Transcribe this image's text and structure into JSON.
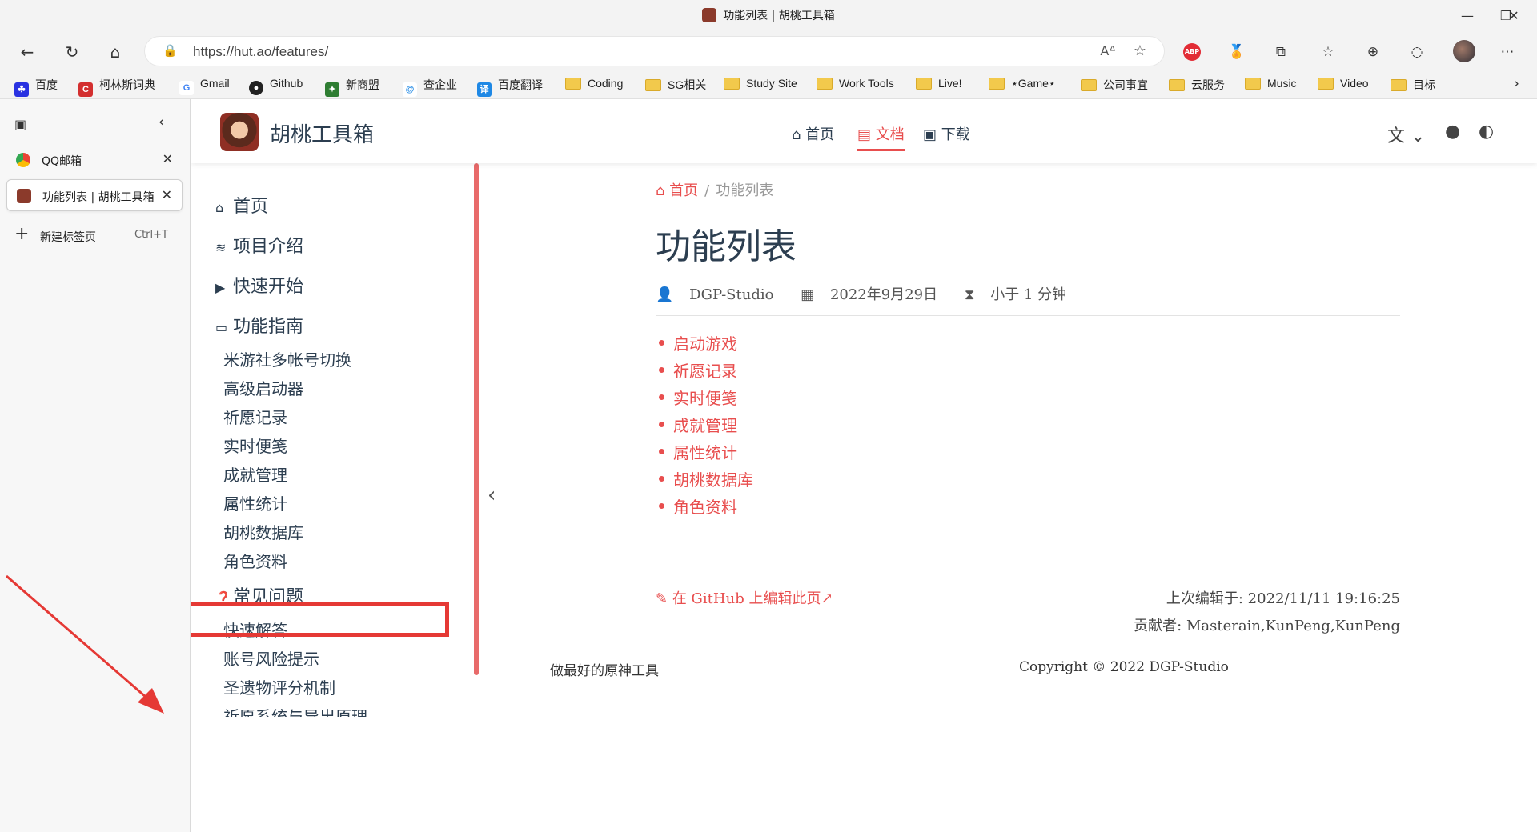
{
  "browser": {
    "window_title": "功能列表 | 胡桃工具箱",
    "url": "https://hut.ao/features/",
    "bookmarks": [
      "百度",
      "柯林斯词典",
      "Gmail",
      "Github",
      "新商盟",
      "查企业",
      "百度翻译",
      "Coding",
      "SG相关",
      "Study Site",
      "Work Tools",
      "Live!",
      "⋆Game⋆",
      "公司事宜",
      "云服务",
      "Music",
      "Video",
      "目标"
    ],
    "vertical_tabs": [
      {
        "label": "QQ邮箱",
        "active": false
      },
      {
        "label": "功能列表 | 胡桃工具箱",
        "active": true
      }
    ],
    "new_tab": {
      "label": "新建标签页",
      "shortcut": "Ctrl+T"
    }
  },
  "site": {
    "name": "胡桃工具箱",
    "nav": [
      {
        "label": "首页",
        "icon": "home-icon"
      },
      {
        "label": "文档",
        "icon": "book-icon",
        "active": true
      },
      {
        "label": "下载",
        "icon": "download-icon"
      }
    ]
  },
  "sidebar": {
    "groups": [
      {
        "label": "首页",
        "icon": "home-icon"
      },
      {
        "label": "项目介绍",
        "icon": "layers-icon"
      },
      {
        "label": "快速开始",
        "icon": "play-icon"
      },
      {
        "label": "功能指南",
        "icon": "guide-icon"
      }
    ],
    "guide_items": [
      "米游社多帐号切换",
      "高级启动器",
      "祈愿记录",
      "实时便笺",
      "成就管理",
      "属性统计",
      "胡桃数据库",
      "角色资料"
    ],
    "faq_group": {
      "label": "常见问题",
      "icon": "question-icon"
    },
    "faq_items": [
      "快速解答",
      "账号风险提示",
      "圣遗物评分机制",
      "祈愿系统与导出原理"
    ]
  },
  "main": {
    "breadcrumb": {
      "home": "首页",
      "current": "功能列表"
    },
    "title": "功能列表",
    "meta": {
      "author": "DGP-Studio",
      "date": "2022年9月29日",
      "reading_time": "小于 1 分钟"
    },
    "features": [
      "启动游戏",
      "祈愿记录",
      "实时便笺",
      "成就管理",
      "属性统计",
      "胡桃数据库",
      "角色资料"
    ],
    "edit_link": "在 GitHub 上编辑此页",
    "last_edit": "上次编辑于: 2022/11/11 19:16:25",
    "contributors": "贡献者: Masterain,KunPeng,KunPeng"
  },
  "footer": {
    "left": "做最好的原神工具",
    "right": "Copyright © 2022 DGP-Studio"
  },
  "colors": {
    "accent": "#e84e4e",
    "highlight_box": "#e53935",
    "text": "#2c3e50"
  }
}
